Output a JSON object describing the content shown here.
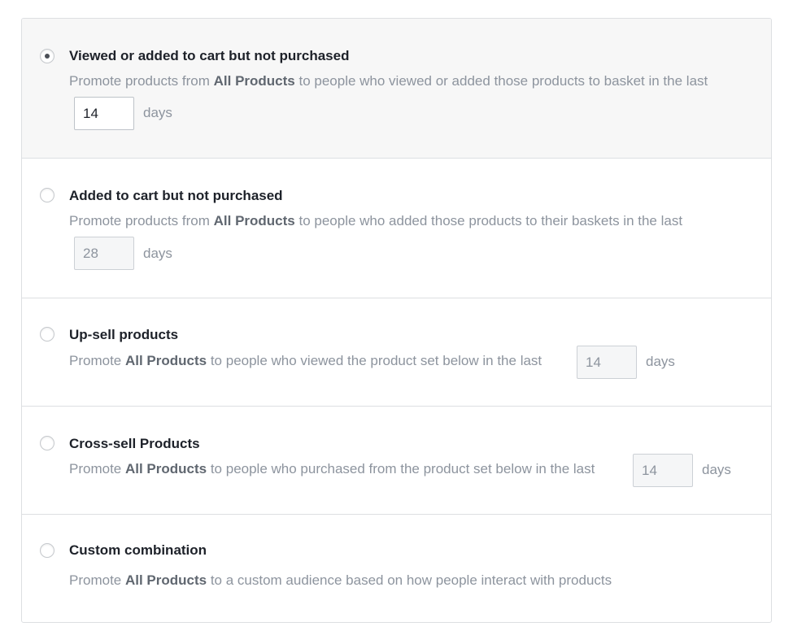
{
  "options": [
    {
      "title": "Viewed or added to cart but not purchased",
      "desc_prefix": "Promote products from ",
      "desc_bold": "All Products",
      "desc_suffix": " to people who viewed or added those products to basket in the last",
      "days_value": "14",
      "days_label": "days",
      "selected": true
    },
    {
      "title": "Added to cart but not purchased",
      "desc_prefix": "Promote products from ",
      "desc_bold": "All Products",
      "desc_suffix": " to people who added those products to their baskets in the last",
      "days_value": "28",
      "days_label": "days",
      "selected": false
    },
    {
      "title": "Up-sell products",
      "desc_prefix": "Promote ",
      "desc_bold": "All Products",
      "desc_suffix": " to people who viewed the product set below in the last",
      "days_value": "14",
      "days_label": "days",
      "selected": false
    },
    {
      "title": "Cross-sell Products",
      "desc_prefix": "Promote ",
      "desc_bold": "All Products",
      "desc_suffix": " to people who purchased from the product set below in the last",
      "days_value": "14",
      "days_label": "days",
      "selected": false
    },
    {
      "title": "Custom combination",
      "desc_prefix": "Promote ",
      "desc_bold": "All Products",
      "desc_suffix": " to a custom audience based on how people interact with products",
      "selected": false
    }
  ]
}
